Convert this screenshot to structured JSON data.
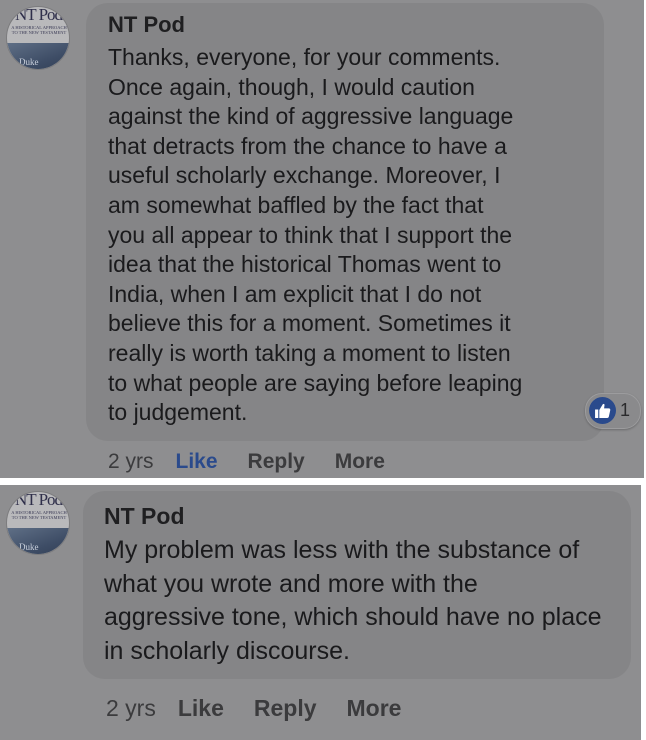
{
  "comments": [
    {
      "author": "NT Pod",
      "avatar_logo_title": "NT Pod",
      "avatar_logo_subtitle": "A Historical Approach to the New Testament",
      "avatar_label": "Duke",
      "text": "Thanks, everyone, for your comments.\nOnce again, though, I would caution\nagainst the kind of aggressive language\nthat detracts from the chance to have a\nuseful scholarly exchange. Moreover, I\nam somewhat baffled by the fact that\nyou all appear to think that I support the\nidea that the historical Thomas went to\nIndia, when I am explicit that I do not\nbelieve this for a moment. Sometimes it\nreally is worth taking a moment to listen\nto what people are saying before leaping\nto judgement.",
      "reaction_icon": "thumbs-up-icon",
      "reaction_count": "1",
      "time": "2 yrs",
      "like_label": "Like",
      "reply_label": "Reply",
      "more_label": "More",
      "like_active": true
    },
    {
      "author": "NT Pod",
      "avatar_logo_title": "NT Pod",
      "avatar_logo_subtitle": "A Historical Approach to the New Testament",
      "avatar_label": "Duke",
      "text": "My problem was less with the substance of\nwhat you wrote and more with the\naggressive tone, which should have no place\nin scholarly discourse.",
      "time": "2 yrs",
      "like_label": "Like",
      "reply_label": "Reply",
      "more_label": "More",
      "like_active": false
    }
  ],
  "colors": {
    "panel_bg": "#8e8e90",
    "bubble_bg": "#858587",
    "like_active": "#2a4a8c"
  }
}
